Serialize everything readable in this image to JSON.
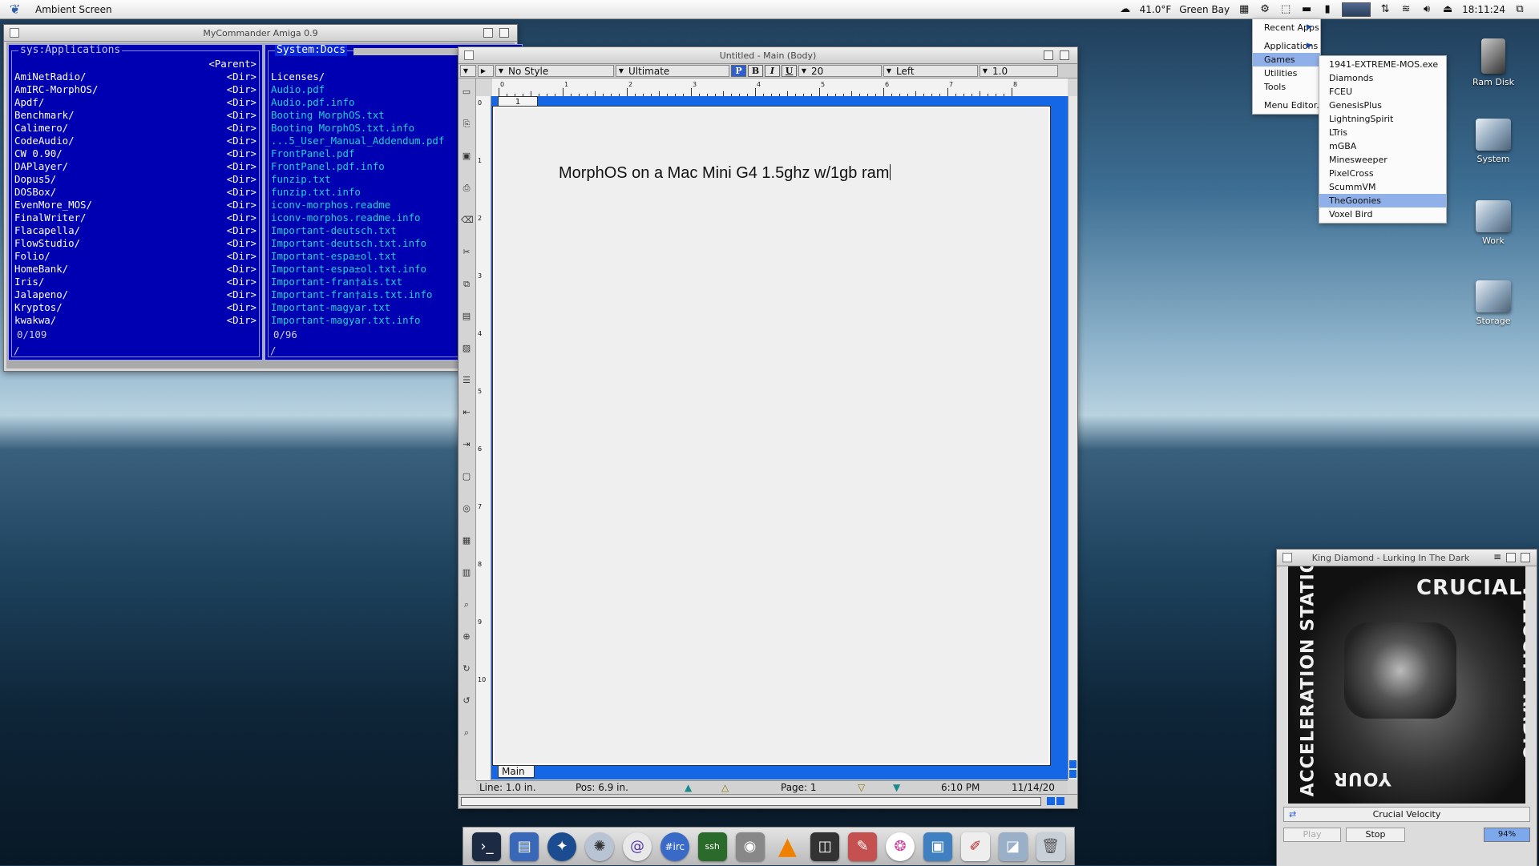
{
  "menubar": {
    "app_name": "Ambient Screen",
    "weather": "41.0°F",
    "location": "Green Bay",
    "time": "18:11:24"
  },
  "mycommander": {
    "title": "MyCommander Amiga 0.9",
    "left": {
      "path": "sys:Applications",
      "parent": "<Parent>",
      "entries": [
        {
          "name": "AmiNetRadio/",
          "type": "<Dir>"
        },
        {
          "name": "AmIRC-MorphOS/",
          "type": "<Dir>"
        },
        {
          "name": "Apdf/",
          "type": "<Dir>"
        },
        {
          "name": "Benchmark/",
          "type": "<Dir>"
        },
        {
          "name": "Calimero/",
          "type": "<Dir>"
        },
        {
          "name": "CodeAudio/",
          "type": "<Dir>"
        },
        {
          "name": "CW 0.90/",
          "type": "<Dir>"
        },
        {
          "name": "DAPlayer/",
          "type": "<Dir>"
        },
        {
          "name": "Dopus5/",
          "type": "<Dir>"
        },
        {
          "name": "DOSBox/",
          "type": "<Dir>"
        },
        {
          "name": "EvenMore_MOS/",
          "type": "<Dir>"
        },
        {
          "name": "FinalWriter/",
          "type": "<Dir>"
        },
        {
          "name": "Flacapella/",
          "type": "<Dir>"
        },
        {
          "name": "FlowStudio/",
          "type": "<Dir>"
        },
        {
          "name": "Folio/",
          "type": "<Dir>"
        },
        {
          "name": "HomeBank/",
          "type": "<Dir>"
        },
        {
          "name": "Iris/",
          "type": "<Dir>"
        },
        {
          "name": "Jalapeno/",
          "type": "<Dir>"
        },
        {
          "name": "Kryptos/",
          "type": "<Dir>"
        },
        {
          "name": "kwakwa/",
          "type": "<Dir>"
        }
      ],
      "count": "0/109",
      "cmdline": "/"
    },
    "right": {
      "path": "System:Docs",
      "entries": [
        "Licenses/",
        "Audio.pdf",
        "Audio.pdf.info",
        "Booting MorphOS.txt",
        "Booting MorphOS.txt.info",
        "...5_User_Manual_Addendum.pdf",
        "FrontPanel.pdf",
        "FrontPanel.pdf.info",
        "funzip.txt",
        "funzip.txt.info",
        "iconv-morphos.readme",
        "iconv-morphos.readme.info",
        "Important-deutsch.txt",
        "Important-deutsch.txt.info",
        "Important-espa±ol.txt",
        "Important-espa±ol.txt.info",
        "Important-fran†ais.txt",
        "Important-fran†ais.txt.info",
        "Important-magyar.txt",
        "Important-magyar.txt.info"
      ],
      "count": "0/96",
      "cmdline": "/"
    }
  },
  "wordproc": {
    "title": "Untitled - Main (Body)",
    "toolbar": {
      "style": "No Style",
      "font": "Ultimate",
      "bold": "B",
      "italic": "I",
      "underline": "U",
      "plain": "P",
      "size": "20",
      "align": "Left",
      "spacing": "1.0"
    },
    "ruler_labels": [
      "0",
      "1",
      "2",
      "3",
      "4",
      "5",
      "6",
      "7",
      "8"
    ],
    "vruler_labels": [
      "0",
      "1",
      "2",
      "3",
      "4",
      "5",
      "6",
      "7",
      "8",
      "9",
      "10"
    ],
    "page_tab": "1",
    "body_text": "MorphOS on a Mac Mini G4 1.5ghz w/1gb ram",
    "section_tab": "Main",
    "status": {
      "line": "Line: 1.0 in.",
      "pos": "Pos: 6.9 in.",
      "page": "Page: 1",
      "time": "6:10 PM",
      "date": "11/14/20"
    }
  },
  "start_menu": {
    "items": [
      {
        "label": "Recent Apps",
        "sub": true
      },
      {
        "label": "Applications",
        "sub": true
      },
      {
        "label": "Games",
        "sub": false,
        "selected": true
      },
      {
        "label": "Utilities",
        "sub": false
      },
      {
        "label": "Tools",
        "sub": false
      },
      {
        "label": "Menu Editor...",
        "sub": false
      }
    ]
  },
  "games_menu": {
    "items": [
      "1941-EXTREME-MOS.exe",
      "Diamonds",
      "FCEU",
      "GenesisPlus",
      "LightningSpirit",
      "LTris",
      "mGBA",
      "Minesweeper",
      "PixelCross",
      "ScummVM",
      "TheGoonies",
      "Voxel Bird"
    ],
    "selected": "TheGoonies"
  },
  "desktop_icons": [
    "Ram Disk",
    "System",
    "Work",
    "Storage"
  ],
  "player": {
    "title": "King Diamond - Lurking In The Dark",
    "cover_text": {
      "top": "CRUCIAL",
      "right": "VELOCITY RADIO",
      "left": "ACCELERATION STATION",
      "bottom": "YOUR"
    },
    "station": "Crucial Velocity",
    "play": "Play",
    "stop": "Stop",
    "volume": "94%"
  },
  "dock": {
    "irc_label": "#irc",
    "ssh_label": "ssh"
  }
}
